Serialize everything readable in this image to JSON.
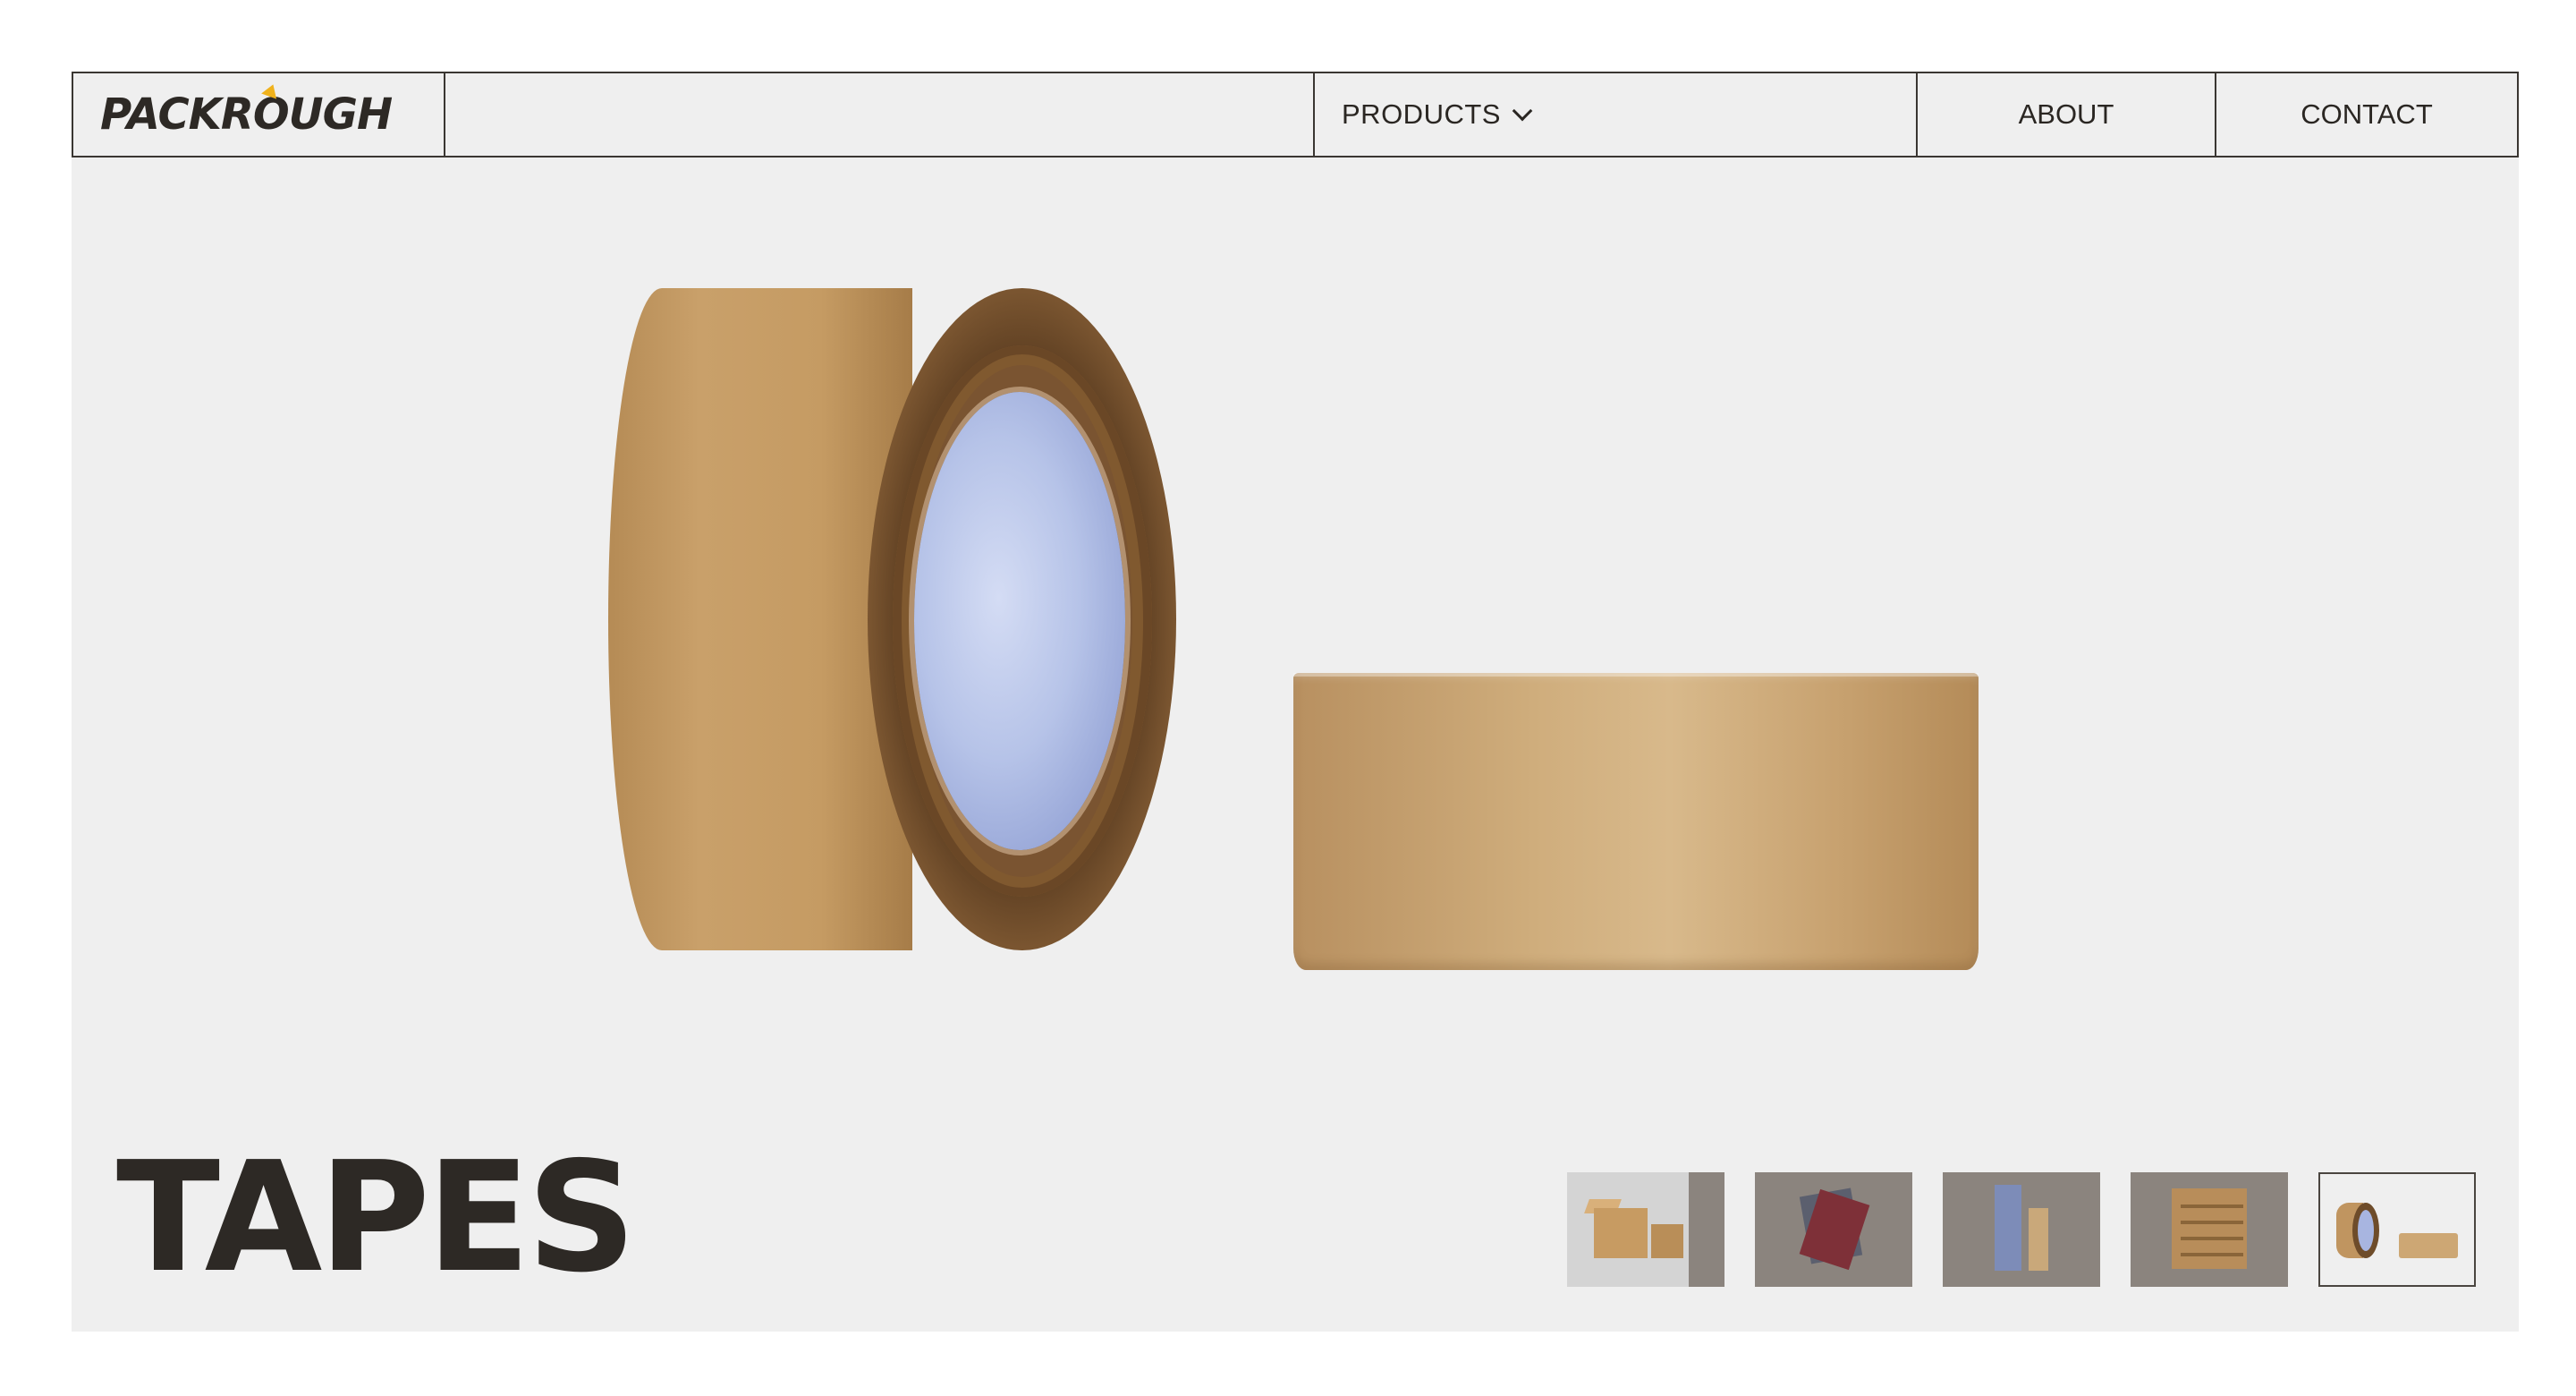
{
  "brand": {
    "logo_text": "PACKROUGH",
    "accent_color": "#f0b21c",
    "text_color": "#2d2925"
  },
  "nav": {
    "products_label": "PRODUCTS",
    "about_label": "ABOUT",
    "contact_label": "CONTACT"
  },
  "hero": {
    "title": "TAPES",
    "background": "#efefef",
    "image_description_icons": [
      "tape-roll-standing",
      "tape-roll-flat"
    ]
  },
  "thumbnails": [
    {
      "name": "boxes",
      "active": false
    },
    {
      "name": "paper-sheets",
      "active": false
    },
    {
      "name": "tubes",
      "active": false
    },
    {
      "name": "shelf-box",
      "active": false
    },
    {
      "name": "tapes",
      "active": true
    }
  ]
}
